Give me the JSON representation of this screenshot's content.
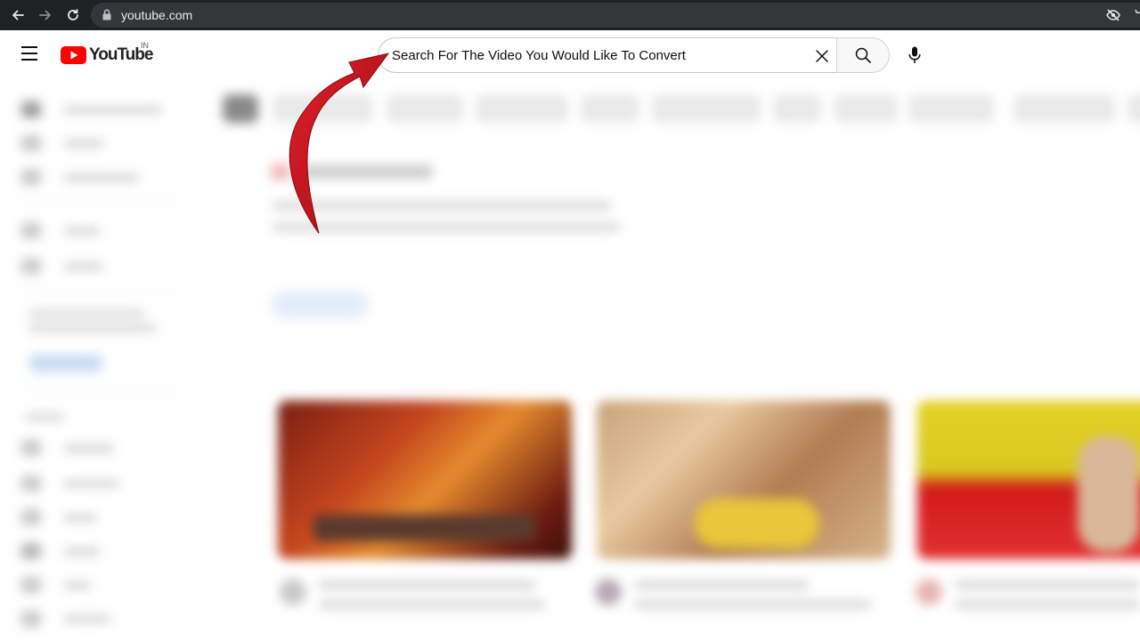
{
  "browser": {
    "url": "youtube.com"
  },
  "header": {
    "logo_text": "YouTube",
    "region": "IN",
    "search": {
      "query": "Search For The Video You Would Like To Convert"
    }
  },
  "icons": {
    "back": "back-arrow-icon",
    "forward": "forward-arrow-icon",
    "reload": "reload-icon",
    "lock": "lock-icon",
    "eye_off": "eye-off-icon",
    "menu": "hamburger-menu-icon",
    "clear": "close-icon",
    "search": "search-icon",
    "mic": "microphone-icon"
  },
  "colors": {
    "brand_red": "#ff0000",
    "annotation_arrow": "#c4121a",
    "chrome_dark": "#202124"
  }
}
